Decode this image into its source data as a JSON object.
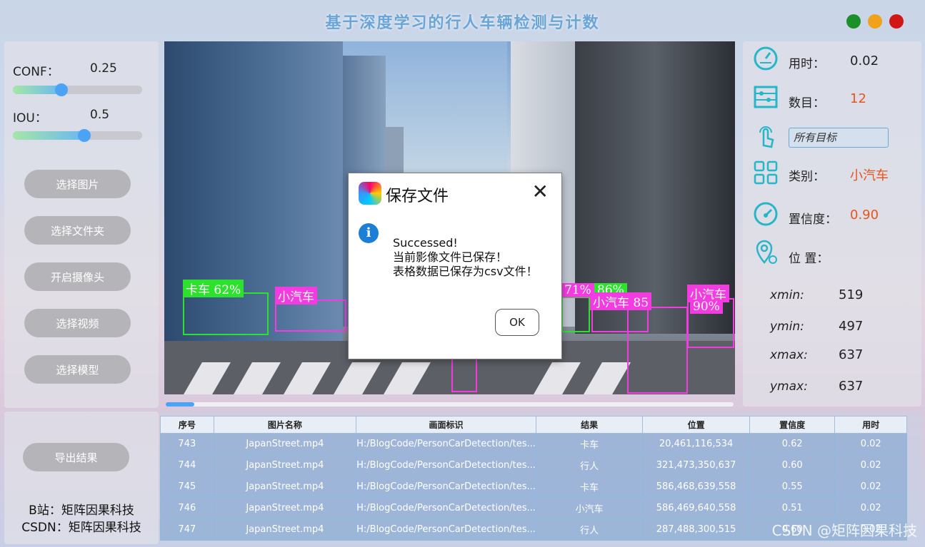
{
  "app": {
    "title": "基于深度学习的行人车辆检测与计数"
  },
  "window_controls": {
    "colors": [
      "#1a8f2a",
      "#f0a21b",
      "#d11616"
    ]
  },
  "params": {
    "conf": {
      "label": "CONF：",
      "value": "0.25",
      "fraction": 0.25
    },
    "iou": {
      "label": "IOU：",
      "value": "0.5",
      "fraction": 0.5
    }
  },
  "buttons": {
    "select_image": "选择图片",
    "select_folder": "选择文件夹",
    "open_camera": "开启摄像头",
    "select_video": "选择视频",
    "select_model": "选择模型",
    "export": "导出结果"
  },
  "detections": [
    {
      "label": "卡车  62%",
      "color": "#2de22d"
    },
    {
      "label": "小汽车",
      "color": "#f23ce1"
    },
    {
      "label": "71%",
      "color": "#f23ce1"
    },
    {
      "label": "86%",
      "color": "#2de22d"
    },
    {
      "label": "小汽车 85",
      "color": "#f23ce1"
    },
    {
      "label": "小汽车",
      "color": "#f23ce1"
    },
    {
      "label": "90%",
      "color": "#f23ce1"
    }
  ],
  "progress": 0.05,
  "dialog": {
    "title": "保存文件",
    "close": "✕",
    "info_glyph": "i",
    "line1": "Successed!",
    "line2": "当前影像文件已保存！",
    "line3": "表格数据已保存为csv文件！",
    "ok": "OK"
  },
  "info": {
    "time_label": "用时：",
    "time_value": "0.02",
    "count_label": "数目：",
    "count_value": "12",
    "target_value": "所有目标",
    "class_label": "类别：",
    "class_value": "小汽车",
    "conf_label": "置信度：",
    "conf_value": "0.90",
    "pos_label": "位 置：",
    "xmin_label": "xmin:",
    "xmin_value": "519",
    "ymin_label": "ymin:",
    "ymin_value": "497",
    "xmax_label": "xmax:",
    "xmax_value": "637",
    "ymax_label": "ymax:",
    "ymax_value": "637",
    "accent_color": "#e8541a"
  },
  "credits": {
    "line1": "B站：矩阵因果科技",
    "line2": "CSDN：矩阵因果科技"
  },
  "table": {
    "headers": [
      "序号",
      "图片名称",
      "画面标识",
      "结果",
      "位置",
      "置信度",
      "用时"
    ],
    "rows": [
      [
        "743",
        "JapanStreet.mp4",
        "H:/BlogCode/PersonCarDetection/tes...",
        "卡车",
        "20,461,116,534",
        "0.62",
        "0.02"
      ],
      [
        "744",
        "JapanStreet.mp4",
        "H:/BlogCode/PersonCarDetection/tes...",
        "行人",
        "321,473,350,637",
        "0.60",
        "0.02"
      ],
      [
        "745",
        "JapanStreet.mp4",
        "H:/BlogCode/PersonCarDetection/tes...",
        "卡车",
        "586,468,639,558",
        "0.55",
        "0.02"
      ],
      [
        "746",
        "JapanStreet.mp4",
        "H:/BlogCode/PersonCarDetection/tes...",
        "小汽车",
        "586,469,640,558",
        "0.51",
        "0.02"
      ],
      [
        "747",
        "JapanStreet.mp4",
        "H:/BlogCode/PersonCarDetection/tes...",
        "行人",
        "287,488,300,515",
        "0.60",
        "0.02"
      ]
    ]
  },
  "watermark": "CSDN @矩阵因果科技"
}
